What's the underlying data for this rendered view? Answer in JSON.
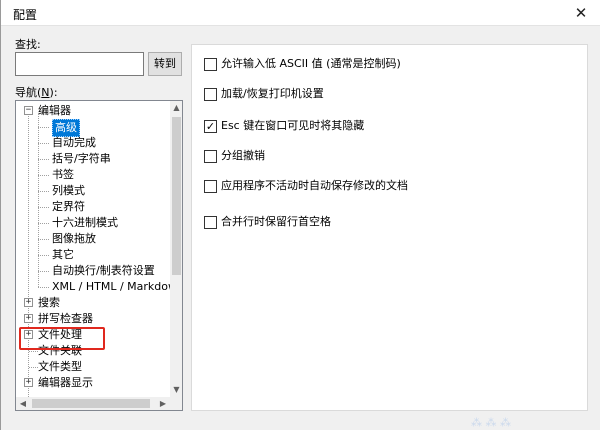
{
  "window": {
    "title": "配置",
    "close_glyph": "✕"
  },
  "search": {
    "label": "查找:",
    "value": "",
    "button": "转到"
  },
  "nav": {
    "label_prefix": "导航(",
    "label_key": "N",
    "label_suffix": "):"
  },
  "tree": {
    "groups": [
      {
        "label": "编辑器",
        "expanded": true,
        "children": [
          "高级",
          "自动完成",
          "括号/字符串",
          "书签",
          "列模式",
          "定界符",
          "十六进制模式",
          "图像拖放",
          "其它",
          "自动换行/制表符设置",
          "XML / HTML / Markdow"
        ],
        "selected_child": 0
      },
      {
        "label": "搜索",
        "expanded": false
      },
      {
        "label": "拼写检查器",
        "expanded": false
      },
      {
        "label": "文件处理",
        "expanded": false,
        "highlighted": true
      },
      {
        "label": "文件关联",
        "leaf": true
      },
      {
        "label": "文件类型",
        "leaf": true
      },
      {
        "label": "编辑器显示",
        "expanded": false
      }
    ],
    "expand_glyph": "+",
    "collapse_glyph": "−",
    "highlight_color": "#e0281e",
    "selection_color": "#0078d7"
  },
  "scrollbar": {
    "up": "▲",
    "down": "▼",
    "left": "◀",
    "right": "▶"
  },
  "options": [
    {
      "label": "允许输入低 ASCII 值 (通常是控制码)",
      "checked": false
    },
    {
      "label": "加载/恢复打印机设置",
      "checked": false
    },
    {
      "label": "Esc 键在窗口可见时将其隐藏",
      "checked": true
    },
    {
      "label": "分组撤销",
      "checked": false
    },
    {
      "label": "应用程序不活动时自动保存修改的文档",
      "checked": false
    },
    {
      "label": "合并行时保留行首空格",
      "checked": false
    }
  ],
  "checkmark_glyph": "✓"
}
